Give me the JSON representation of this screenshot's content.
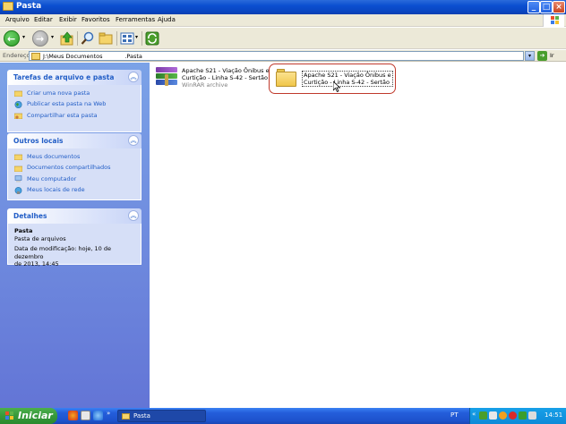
{
  "window": {
    "title": "Pasta",
    "controls": [
      "minimize",
      "maximize",
      "close"
    ]
  },
  "menubar": {
    "items": [
      "Arquivo",
      "Editar",
      "Exibir",
      "Favoritos",
      "Ferramentas",
      "Ajuda"
    ]
  },
  "toolbar": {
    "back_arrow": "←",
    "forward_arrow": "→",
    "dropdown": "▾",
    "icons": [
      "back-icon",
      "forward-icon",
      "up-folder-icon",
      "search-icon",
      "folders-icon",
      "views-icon",
      "sync-icon"
    ]
  },
  "address": {
    "label": "Endereço",
    "value": "J:\\Meus Documentos            .Pasta",
    "dropdown": "▾",
    "go_label": "Ir",
    "go_arrow": "➔"
  },
  "taskpane": {
    "tasks": {
      "title": "Tarefas de arquivo e pasta",
      "toggle": "︽",
      "links": [
        "Criar uma nova pasta",
        "Publicar esta pasta na Web",
        "Compartilhar esta pasta"
      ]
    },
    "places": {
      "title": "Outros locais",
      "toggle": "︽",
      "links": [
        "Meus documentos",
        "Documentos compartilhados",
        "Meu computador",
        "Meus locais de rede"
      ]
    },
    "details": {
      "title": "Detalhes",
      "toggle": "︽",
      "name": "Pasta",
      "type": "Pasta de arquivos",
      "modified_line1": "Data de modificação: hoje, 10 de dezembro",
      "modified_line2": "de 2013, 14:45"
    }
  },
  "files": [
    {
      "line1": "Apache S21 - Viação Ônibus e",
      "line2": "Curtição - Linha S-42 - Sertão",
      "line3": "WinRAR archive",
      "icon": "winrar-archive-icon"
    },
    {
      "line1": "Apache S21 - Viação Ônibus e",
      "line2": "Curtição - Linha S-42 - Sertão",
      "icon": "folder-icon",
      "selected": true
    }
  ],
  "taskbar": {
    "start_label": "Iniciar",
    "window_button": "Pasta",
    "language": "PT",
    "clock": "14:51"
  },
  "colors": {
    "titlebar": "#0b4fd0",
    "taskpane": "#6f8ce0",
    "taskbar": "#245edb",
    "start": "#36983a",
    "highlight": "#c0392b"
  }
}
